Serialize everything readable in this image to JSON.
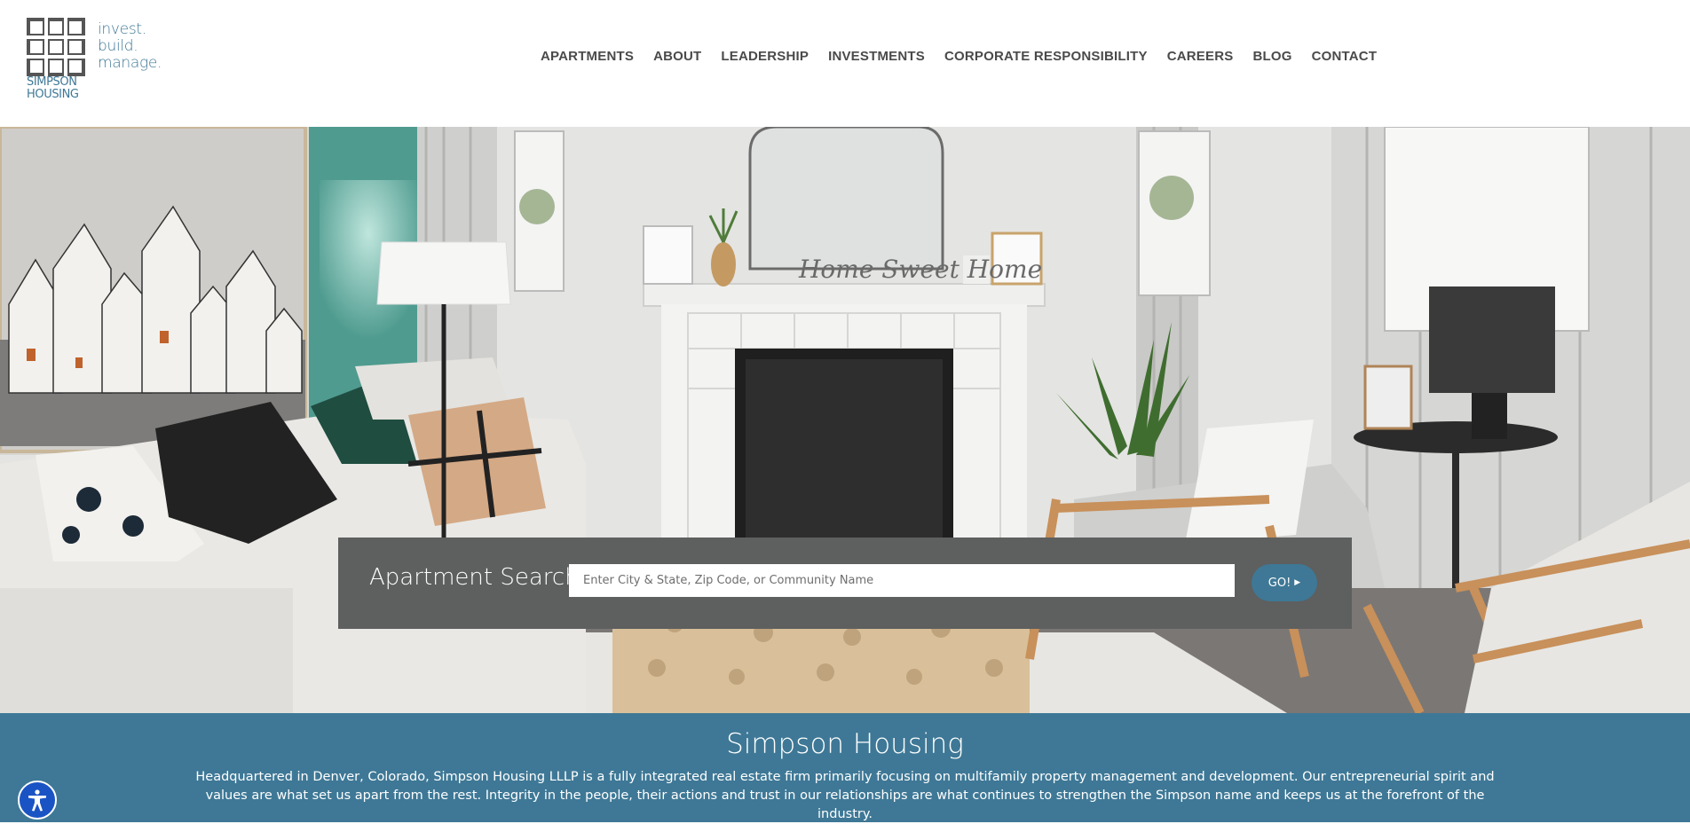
{
  "logo": {
    "tagline": [
      "invest.",
      "build.",
      "manage."
    ],
    "name_line1": "SIMPSON",
    "name_line2": "HOUSING"
  },
  "nav": {
    "items": [
      "APARTMENTS",
      "ABOUT",
      "LEADERSHIP",
      "INVESTMENTS",
      "CORPORATE RESPONSIBILITY",
      "CAREERS",
      "BLOG",
      "CONTACT"
    ]
  },
  "hero": {
    "mantel_sign": "Home Sweet Home"
  },
  "search": {
    "title": "Apartment Search",
    "placeholder": "Enter City & State, Zip Code, or Community Name",
    "value": "",
    "button_label": "GO!"
  },
  "about": {
    "title": "Simpson Housing",
    "text": "Headquartered in Denver, Colorado, Simpson Housing LLLP is a fully integrated real estate firm primarily focusing on multifamily property management and development. Our entrepreneurial spirit and values are what set us apart from the rest. Integrity in the people, their actions and trust in our relationships are what continues to strengthen the Simpson name and keeps us at the forefront of the industry."
  },
  "colors": {
    "brand_blue": "#3e7896",
    "search_panel": "#5e5f5f",
    "accessibility_blue": "#1a54c4"
  },
  "icons": {
    "logo_mark": "grid-squares-logo",
    "go_arrow": "caret-right-icon",
    "accessibility": "accessibility-icon"
  }
}
